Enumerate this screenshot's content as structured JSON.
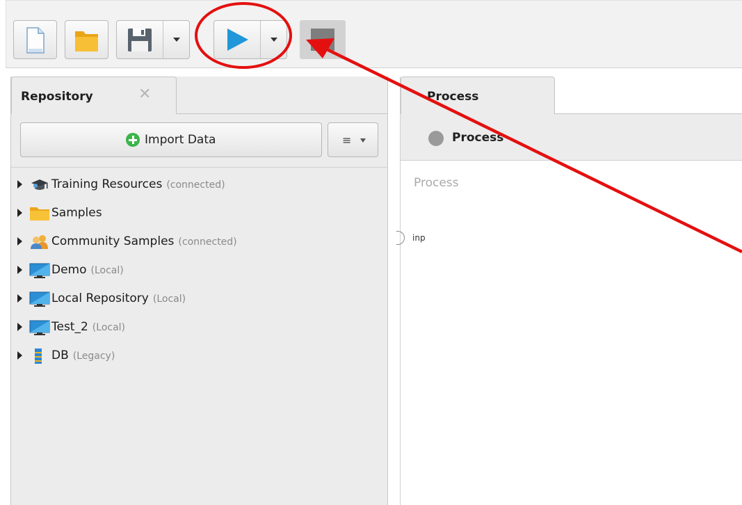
{
  "toolbar": {
    "buttons": [
      "new-process",
      "open-process",
      "save-process",
      "run-process",
      "stop-process"
    ]
  },
  "repository": {
    "tab_label": "Repository",
    "close_glyph": "✕",
    "import_label": "Import Data",
    "menu_glyph": "≡",
    "items": [
      {
        "name": "Training Resources",
        "note": "(connected)",
        "icon": "graduation-cap-icon"
      },
      {
        "name": "Samples",
        "note": "",
        "icon": "folder-icon"
      },
      {
        "name": "Community Samples",
        "note": "(connected)",
        "icon": "people-icon"
      },
      {
        "name": "Demo",
        "note": "(Local)",
        "icon": "monitor-icon"
      },
      {
        "name": "Local Repository",
        "note": "(Local)",
        "icon": "monitor-icon"
      },
      {
        "name": "Test_2",
        "note": "(Local)",
        "icon": "monitor-icon"
      },
      {
        "name": "DB",
        "note": "(Legacy)",
        "icon": "database-icon"
      }
    ]
  },
  "process": {
    "tab_label": "Process",
    "breadcrumb": "Process",
    "canvas_title": "Process",
    "port_label": "inp"
  },
  "colors": {
    "run_blue": "#2196d9",
    "folder_orange": "#f2b320",
    "annotation_red": "#e41010"
  }
}
